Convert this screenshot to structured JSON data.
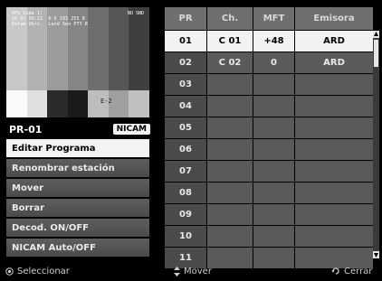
{
  "preview": {
    "osd_lines": "VPS Code 1:\n16 01 09:21  0-5 193 255 8\nDetum Uhrz.  Land Sen PTY R",
    "osd_right": "NO SND",
    "ref_label": "E-2"
  },
  "current": {
    "program": "PR-01",
    "audio_badge": "NICAM"
  },
  "menu": [
    {
      "label": "Editar Programa",
      "selected": true
    },
    {
      "label": "Renombrar estación",
      "selected": false
    },
    {
      "label": "Mover",
      "selected": false
    },
    {
      "label": "Borrar",
      "selected": false
    },
    {
      "label": "Decod. ON/OFF",
      "selected": false
    },
    {
      "label": "NICAM Auto/OFF",
      "selected": false
    }
  ],
  "table": {
    "headers": {
      "pr": "PR",
      "ch": "Ch.",
      "mft": "MFT",
      "station": "Emisora"
    },
    "rows": [
      {
        "pr": "01",
        "ch": "C 01",
        "mft": "+48",
        "station": "ARD",
        "selected": true
      },
      {
        "pr": "02",
        "ch": "C 02",
        "mft": "0",
        "station": "ARD",
        "selected": false
      },
      {
        "pr": "03",
        "ch": "",
        "mft": "",
        "station": "",
        "selected": false
      },
      {
        "pr": "04",
        "ch": "",
        "mft": "",
        "station": "",
        "selected": false
      },
      {
        "pr": "05",
        "ch": "",
        "mft": "",
        "station": "",
        "selected": false
      },
      {
        "pr": "06",
        "ch": "",
        "mft": "",
        "station": "",
        "selected": false
      },
      {
        "pr": "07",
        "ch": "",
        "mft": "",
        "station": "",
        "selected": false
      },
      {
        "pr": "08",
        "ch": "",
        "mft": "",
        "station": "",
        "selected": false
      },
      {
        "pr": "09",
        "ch": "",
        "mft": "",
        "station": "",
        "selected": false
      },
      {
        "pr": "10",
        "ch": "",
        "mft": "",
        "station": "",
        "selected": false
      },
      {
        "pr": "11",
        "ch": "",
        "mft": "",
        "station": "",
        "selected": false
      }
    ]
  },
  "footer": {
    "select_label": "Seleccionar",
    "select_icon": "enter-circle-icon",
    "move_label": "Mover",
    "move_icon": "up-down-arrows-icon",
    "close_label": "Cerrar",
    "close_icon": "return-icon"
  },
  "colors": {
    "selected_bg": "#f2f2f2",
    "cell_bg": "#5a5a5a",
    "header_bg": "#6f6f6f"
  }
}
